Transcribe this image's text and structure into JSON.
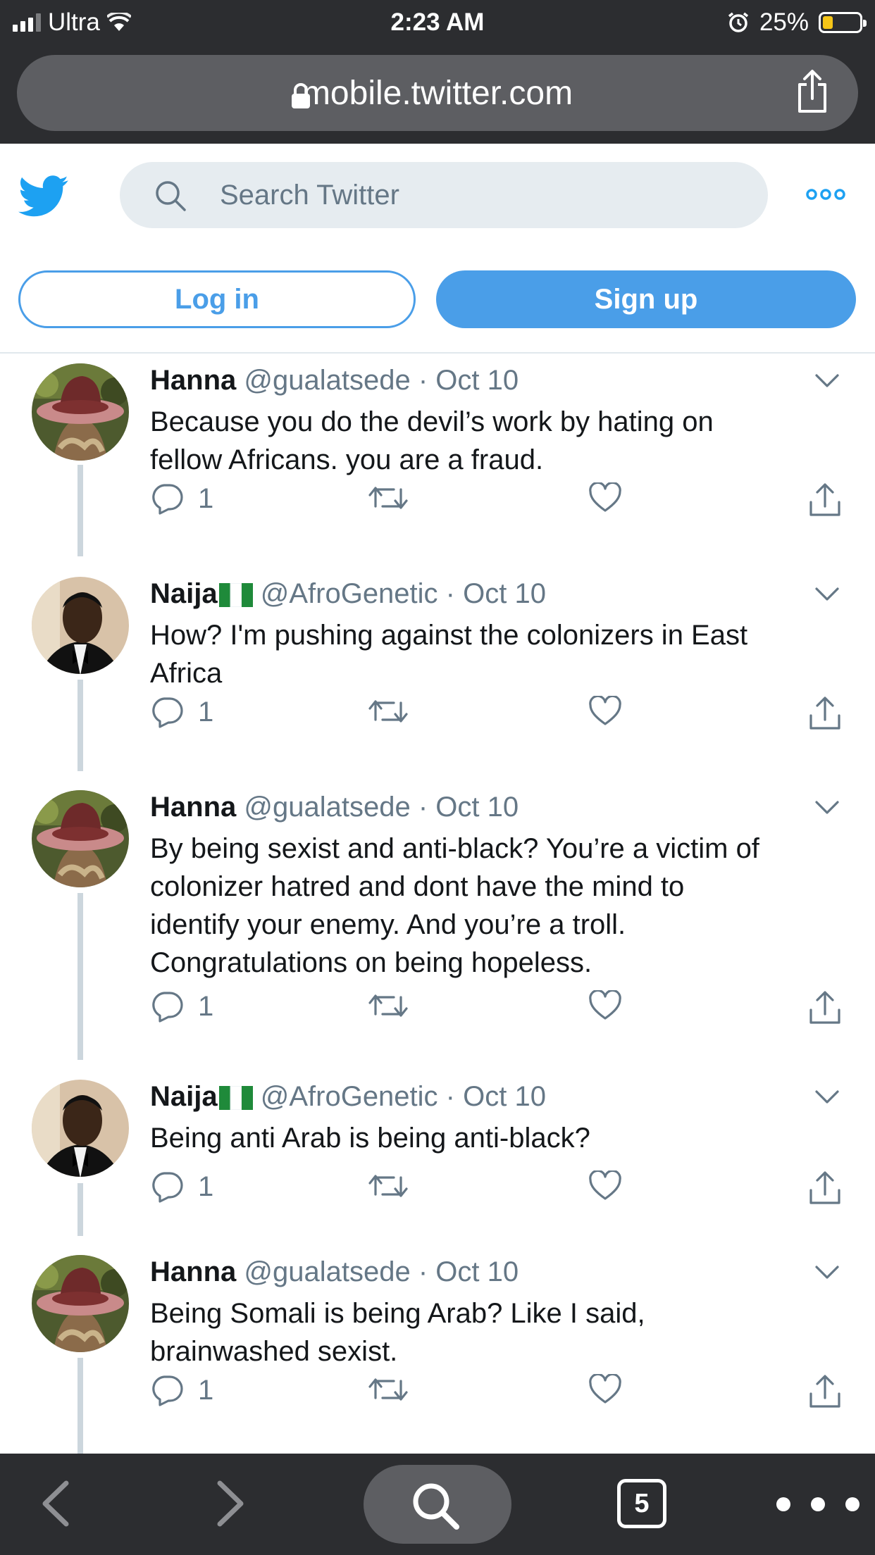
{
  "status_bar": {
    "carrier": "Ultra",
    "time": "2:23 AM",
    "battery": "25%"
  },
  "browser": {
    "url": "mobile.twitter.com",
    "open_tabs": "5"
  },
  "twitter": {
    "search_placeholder": "Search Twitter",
    "login_label": "Log in",
    "signup_label": "Sign up"
  },
  "colors": {
    "brand": "#4a9ee8",
    "chrome": "#2c2d30",
    "secondary_text": "#657786",
    "thread_line": "#ccd6dd"
  },
  "tweets": [
    {
      "name": "Hanna",
      "flag": false,
      "handle": "@gualatsede",
      "date": "Oct 10",
      "lines": [
        "Because you do the devil’s work by hating on",
        "fellow Africans. you are a fraud."
      ],
      "replies": "1"
    },
    {
      "name": "Naija",
      "flag": true,
      "handle": "@AfroGenetic",
      "date": "Oct 10",
      "lines": [
        "How? I'm pushing against the colonizers in East",
        "Africa"
      ],
      "replies": "1"
    },
    {
      "name": "Hanna",
      "flag": false,
      "handle": "@gualatsede",
      "date": "Oct 10",
      "lines": [
        "By being sexist and anti-black? You’re a victim of",
        "colonizer hatred and dont have the mind to",
        "identify your enemy. And you’re a troll.",
        "Congratulations on being hopeless."
      ],
      "replies": "1"
    },
    {
      "name": "Naija",
      "flag": true,
      "handle": "@AfroGenetic",
      "date": "Oct 10",
      "lines": [
        "Being anti Arab is being anti-black?"
      ],
      "replies": "1"
    },
    {
      "name": "Hanna",
      "flag": false,
      "handle": "@gualatsede",
      "date": "Oct 10",
      "lines": [
        "Being Somali is being Arab? Like I said,",
        "brainwashed sexist."
      ],
      "replies": "1"
    }
  ]
}
